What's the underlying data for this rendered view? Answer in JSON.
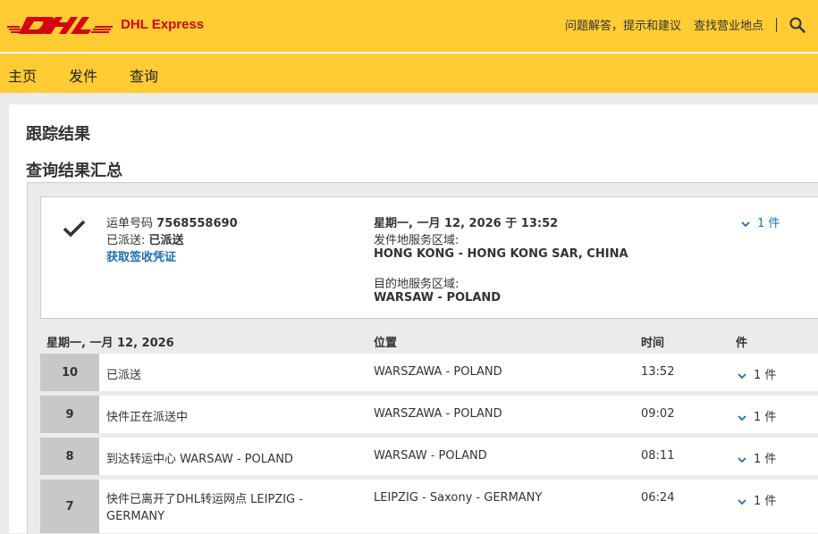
{
  "header": {
    "brand": "DHL Express",
    "links": [
      "问题解答，提示和建议",
      "查找营业地点"
    ]
  },
  "nav": [
    "主页",
    "发件",
    "查询"
  ],
  "page": {
    "title": "跟踪结果",
    "subtitle": "查询结果汇总"
  },
  "summary": {
    "waybill_label": "运单号码",
    "waybill_number": "7568558690",
    "status_label": "已派送:",
    "status_value": "已派送",
    "proof_link": "获取签收凭证",
    "datetime": "星期一, 一月 12, 2026 于 13:52",
    "origin_label": "发件地服务区域:",
    "origin_value": "HONG KONG - HONG KONG SAR, CHINA",
    "dest_label": "目的地服务区域:",
    "dest_value": "WARSAW - POLAND",
    "pieces": "1 件"
  },
  "table": {
    "headers": {
      "date": "星期一, 一月 12, 2026",
      "location": "位置",
      "time": "时间",
      "pieces": "件"
    },
    "rows": [
      {
        "num": "10",
        "event": "已派送",
        "location": "WARSZAWA - POLAND",
        "time": "13:52",
        "pieces": "1 件"
      },
      {
        "num": "9",
        "event": "快件正在派送中",
        "location": "WARSZAWA - POLAND",
        "time": "09:02",
        "pieces": "1 件"
      },
      {
        "num": "8",
        "event": "到达转运中心 WARSAW - POLAND",
        "location": "WARSAW - POLAND",
        "time": "08:11",
        "pieces": "1 件"
      },
      {
        "num": "7",
        "event": "快件已离开了DHL转运网点 LEIPZIG - GERMANY",
        "location": "LEIPZIG - Saxony - GERMANY",
        "time": "06:24",
        "pieces": "1 件"
      }
    ]
  },
  "colors": {
    "dhl_yellow": "#ffcc33",
    "dhl_red": "#d40511",
    "link_blue": "#1a6fb5"
  },
  "icons": [
    "dhl-logo",
    "search-icon",
    "check-icon",
    "chevron-down-icon"
  ]
}
